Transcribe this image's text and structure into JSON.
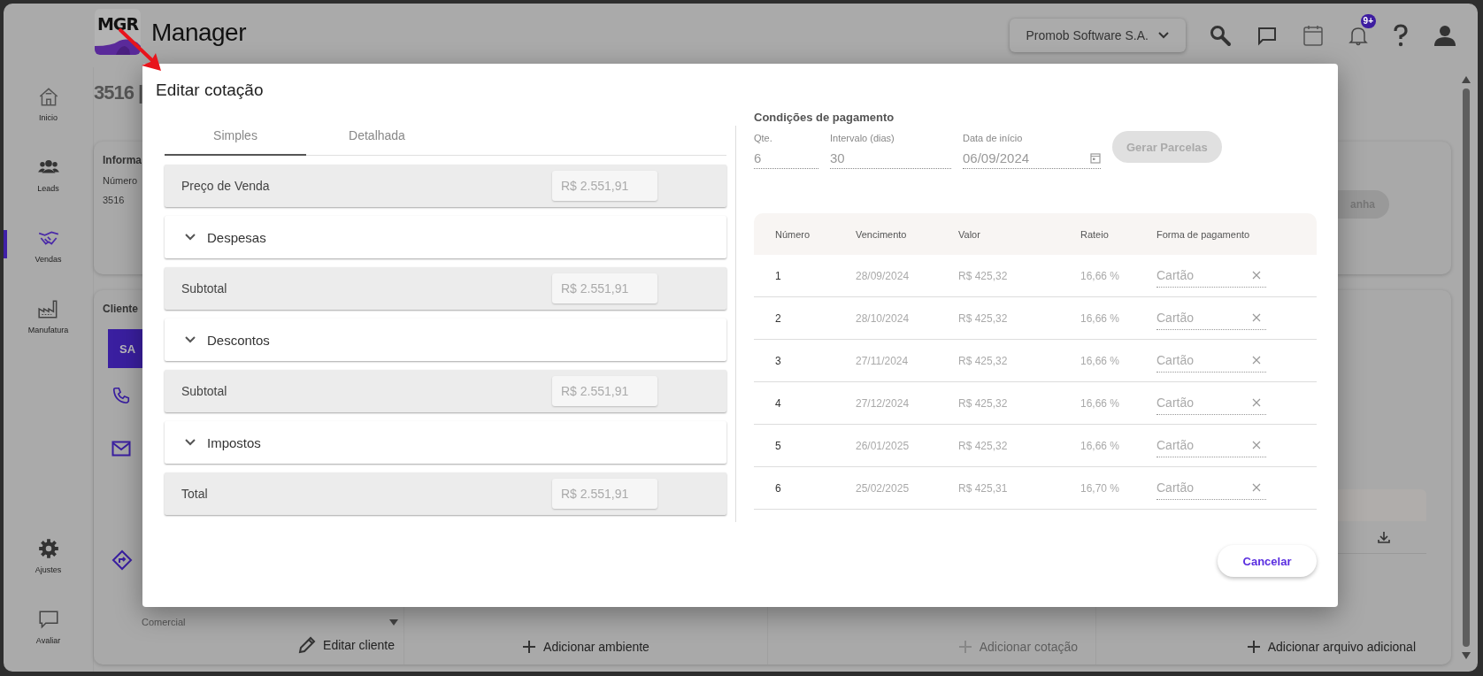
{
  "header": {
    "logo_text": "MGR",
    "app_name": "Manager",
    "company": "Promob Software S.A.",
    "notification_badge": "9+"
  },
  "sidebar": {
    "items": [
      {
        "kind": "home",
        "label": "Inicio",
        "selected": false
      },
      {
        "kind": "leads",
        "label": "Leads",
        "selected": false
      },
      {
        "kind": "sales",
        "label": "Vendas",
        "selected": true
      },
      {
        "kind": "factory",
        "label": "Manufatura",
        "selected": false
      }
    ],
    "bottom_items": [
      {
        "kind": "settings",
        "label": "Ajustes"
      },
      {
        "kind": "feedback",
        "label": "Avaliar"
      }
    ]
  },
  "page": {
    "title": "3516 |",
    "info_card": {
      "title": "Informa",
      "field_label": "Número",
      "field_value": "3516",
      "side_button": "anha"
    },
    "client": {
      "title": "Cliente",
      "avatar": "SA",
      "select_value": "Comercial",
      "edit_button": "Editar cliente"
    },
    "add_environment": {
      "label": "Adicionar ambiente",
      "disabled": false
    },
    "add_quote": {
      "label": "Adicionar cotação",
      "disabled": true
    },
    "add_file": {
      "label": "Adicionar arquivo adicional",
      "disabled": false
    }
  },
  "dialog": {
    "title": "Editar cotação",
    "tabs": [
      {
        "label": "Simples",
        "selected": true
      },
      {
        "label": "Detalhada",
        "selected": false
      }
    ],
    "sections": [
      {
        "kind": "value",
        "label": "Preço de Venda",
        "value": "R$ 2.551,91"
      },
      {
        "kind": "group",
        "label": "Despesas",
        "expanded": false
      },
      {
        "kind": "value",
        "label": "Subtotal",
        "value": "R$ 2.551,91"
      },
      {
        "kind": "group",
        "label": "Descontos",
        "expanded": false
      },
      {
        "kind": "value",
        "label": "Subtotal",
        "value": "R$ 2.551,91"
      },
      {
        "kind": "group",
        "label": "Impostos",
        "expanded": false
      },
      {
        "kind": "value",
        "label": "Total",
        "value": "R$ 2.551,91"
      }
    ],
    "payment": {
      "title": "Condições de pagamento",
      "fields": [
        {
          "kind": "text",
          "label": "Qte.",
          "value": "6"
        },
        {
          "kind": "text",
          "label": "Intervalo (dias)",
          "value": "30"
        },
        {
          "kind": "date",
          "label": "Data de início",
          "value": "06/09/2024"
        }
      ],
      "generate_button": {
        "label": "Gerar Parcelas",
        "disabled": true
      },
      "table": {
        "columns": [
          "Número",
          "Vencimento",
          "Valor",
          "Rateio",
          "Forma de pagamento"
        ],
        "rows": [
          [
            "1",
            "28/09/2024",
            "R$ 425,32",
            "16,66 %",
            "Cartão"
          ],
          [
            "2",
            "28/10/2024",
            "R$ 425,32",
            "16,66 %",
            "Cartão"
          ],
          [
            "3",
            "27/11/2024",
            "R$ 425,32",
            "16,66 %",
            "Cartão"
          ],
          [
            "4",
            "27/12/2024",
            "R$ 425,32",
            "16,66 %",
            "Cartão"
          ],
          [
            "5",
            "26/01/2025",
            "R$ 425,32",
            "16,66 %",
            "Cartão"
          ],
          [
            "6",
            "25/02/2025",
            "R$ 425,31",
            "16,70 %",
            "Cartão"
          ]
        ]
      }
    },
    "cancel_button": "Cancelar"
  }
}
